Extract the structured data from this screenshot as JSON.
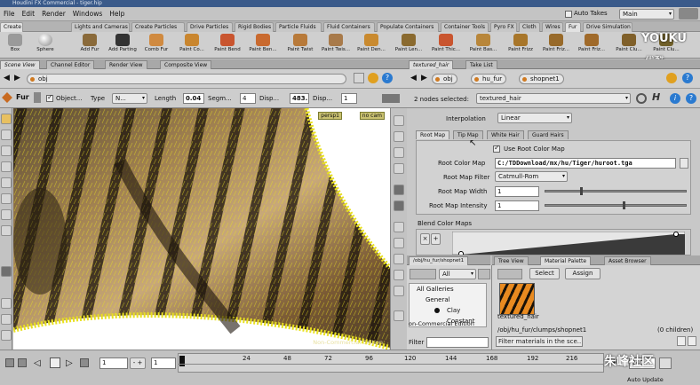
{
  "window": {
    "title": "Houdini FX Commercial - tiger.hip"
  },
  "menu": [
    "File",
    "Edit",
    "Render",
    "Windows",
    "Help"
  ],
  "top_right": {
    "auto_takes": "Auto Takes",
    "desktop": "Main",
    "watermark_top": "YOUKU",
    "watermark_top2": "优酷"
  },
  "shelf_tabs": [
    "Create",
    "Lights and Cameras",
    "Create Particles",
    "Drive Particles",
    "Rigid Bodies",
    "Particle Fluids",
    "Fluid Containers",
    "Populate Containers",
    "Container Tools",
    "Pyro FX",
    "Cloth",
    "Wires",
    "Fur",
    "Drive Simulation"
  ],
  "shelf_tools": [
    "Box",
    "Sphere",
    "Add Fur",
    "Add Parting",
    "Comb Fur",
    "Paint Co...",
    "Paint Bend",
    "Paint Ben...",
    "Paint Twist",
    "Paint Twis...",
    "Paint Den...",
    "Paint Len...",
    "Paint Thic...",
    "Paint Bas...",
    "Paint Frizz",
    "Paint Friz...",
    "Paint Friz...",
    "Paint Clu...",
    "Paint Clu..."
  ],
  "left_tabs": [
    "Scene View",
    "Channel Editor",
    "Render View",
    "Composite View"
  ],
  "left_path": {
    "node": "obj"
  },
  "parm_strip": {
    "node": "Fur",
    "object_label": "Object...",
    "type_label": "Type",
    "type_value": "N...",
    "length_label": "Length",
    "length_value": "0.04",
    "segments_label": "Segm...",
    "segments_value": "4",
    "disp1_label": "Disp...",
    "disp1_value": "483.",
    "disp2_label": "Disp...",
    "disp2_value": "1"
  },
  "viewport": {
    "camera": "persp1",
    "display": "no cam",
    "watermark": "Non-Commercial Edition"
  },
  "right_tabs": [
    "textured_hair",
    "Take List"
  ],
  "right_path": [
    "obj",
    "hu_fur",
    "shopnet1"
  ],
  "parm_header": {
    "nodes_selected": "2 nodes selected:",
    "node": "textured_hair"
  },
  "interpolation": {
    "label": "Interpolation",
    "value": "Linear"
  },
  "map_tabs": [
    "Root Map",
    "Tip Map",
    "White Hair",
    "Guard Hairs"
  ],
  "root_map": {
    "use_label": "Use Root Color Map",
    "color_map_label": "Root Color Map",
    "color_map_value": "C:/TDDownload/mx/hu/Tiger/huroot.tga",
    "filter_label": "Root Map Filter",
    "filter_value": "Catmull-Rom",
    "width_label": "Root Map Width",
    "width_value": "1",
    "width_slider": 0.25,
    "intensity_label": "Root Map Intensity",
    "intensity_value": "1",
    "intensity_slider": 0.55
  },
  "blend": {
    "label": "Blend Color Maps",
    "x_btn": "×",
    "plus_btn": "+"
  },
  "gallery": {
    "path_tab": "/obj/hu_fur/shopnet1",
    "filter_value": "All",
    "tree": [
      "All Galleries",
      "General",
      "Clay",
      "Constant"
    ],
    "watermark": "on-Commercial Edition",
    "filter_label": "Filter"
  },
  "palette": {
    "tabs": [
      "Tree View",
      "Material Palette",
      "Asset Browser"
    ],
    "select_btn": "Select",
    "assign_btn": "Assign",
    "item_label": "textured_hair",
    "path": "/obj/hu_fur/clumps/shopnet1",
    "children": "(0 children)",
    "filter_placeholder": "Filter materials in the sce..."
  },
  "timeline": {
    "frame": "1",
    "start": "1",
    "ticks": [
      "24",
      "48",
      "72",
      "96",
      "120",
      "144",
      "168",
      "192",
      "216",
      "240"
    ],
    "end": "240",
    "auto_update": "Auto Update",
    "watermark": "朱峰社区"
  },
  "colors": {
    "fur": "#e8e020",
    "titlebar": "#3a5a8a",
    "accent": "#d07a20"
  }
}
